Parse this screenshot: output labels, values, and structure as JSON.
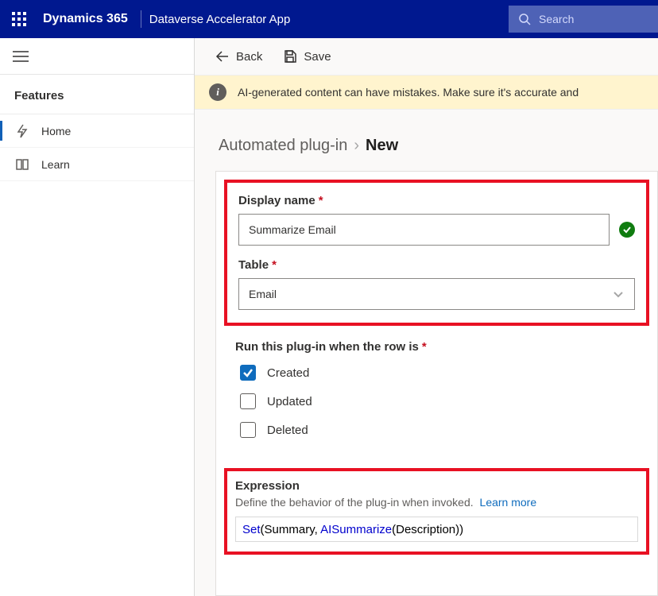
{
  "header": {
    "brand": "Dynamics 365",
    "appname": "Dataverse Accelerator App",
    "search_placeholder": "Search"
  },
  "sidebar": {
    "section_label": "Features",
    "items": [
      {
        "icon": "lightning-icon",
        "label": "Home",
        "selected": true
      },
      {
        "icon": "book-icon",
        "label": "Learn",
        "selected": false
      }
    ]
  },
  "commandbar": {
    "back_label": "Back",
    "save_label": "Save"
  },
  "banner": {
    "text": "AI-generated content can have mistakes. Make sure it's accurate and"
  },
  "breadcrumb": {
    "parent": "Automated plug-in",
    "current": "New"
  },
  "form": {
    "display_name": {
      "label": "Display name",
      "value": "Summarize Email",
      "valid": true
    },
    "table": {
      "label": "Table",
      "value": "Email"
    },
    "run_when": {
      "label": "Run this plug-in when the row is",
      "options": [
        {
          "label": "Created",
          "checked": true
        },
        {
          "label": "Updated",
          "checked": false
        },
        {
          "label": "Deleted",
          "checked": false
        }
      ]
    },
    "expression": {
      "title": "Expression",
      "desc": "Define the behavior of the plug-in when invoked.",
      "learn_more": "Learn more",
      "tokens": [
        {
          "t": "fn",
          "v": "Set"
        },
        {
          "t": "p",
          "v": "("
        },
        {
          "t": "id",
          "v": "Summary"
        },
        {
          "t": "p",
          "v": ", "
        },
        {
          "t": "fn",
          "v": "AISummarize"
        },
        {
          "t": "p",
          "v": "("
        },
        {
          "t": "id",
          "v": "Description"
        },
        {
          "t": "p",
          "v": ")"
        },
        {
          "t": "p",
          "v": ")"
        }
      ]
    }
  }
}
